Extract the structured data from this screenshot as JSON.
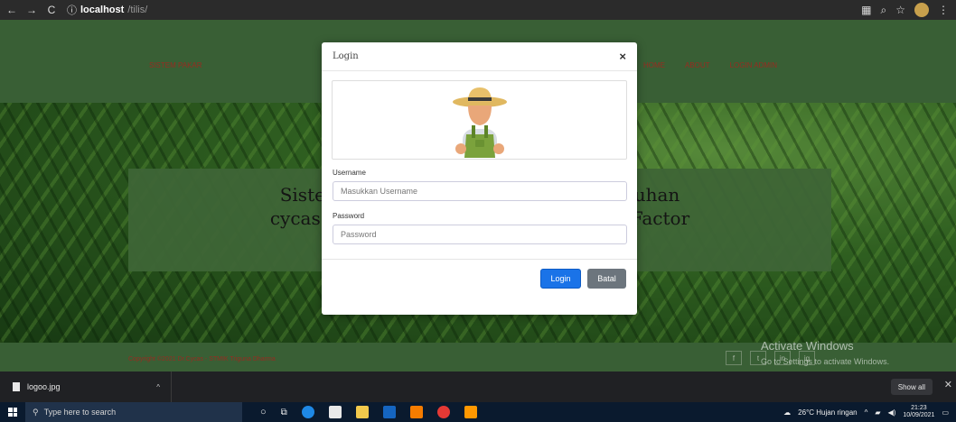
{
  "browser": {
    "host": "localhost",
    "path": "/tilis/"
  },
  "navbar": {
    "brand": "SISTEM PAKAR",
    "links": [
      "HOME",
      "ABOUT",
      "LOGIN ADMIN"
    ]
  },
  "hero": {
    "title": "Sistem Pakar Diagnosa Penyakit Tumbuhan\ncycas Menggunakan Metode Certainty Factor"
  },
  "footer": {
    "copyright": "Copyright ©2021 Dr.Cycas - STMIK Triguna Dharma",
    "socials": [
      "f",
      "t",
      "in",
      "ig"
    ]
  },
  "modal": {
    "title": "Login",
    "close": "×",
    "username_label": "Username",
    "username_placeholder": "Masukkan Username",
    "password_label": "Password",
    "password_placeholder": "Password",
    "login_button": "Login",
    "cancel_button": "Batal"
  },
  "windows_watermark": {
    "title": "Activate Windows",
    "subtitle": "Go to Settings to activate Windows."
  },
  "downloads": {
    "file": "logoo.jpg",
    "show_all": "Show all"
  },
  "taskbar": {
    "search_placeholder": "Type here to search",
    "weather": "26°C  Hujan ringan",
    "time": "21:23",
    "date": "10/09/2021"
  }
}
